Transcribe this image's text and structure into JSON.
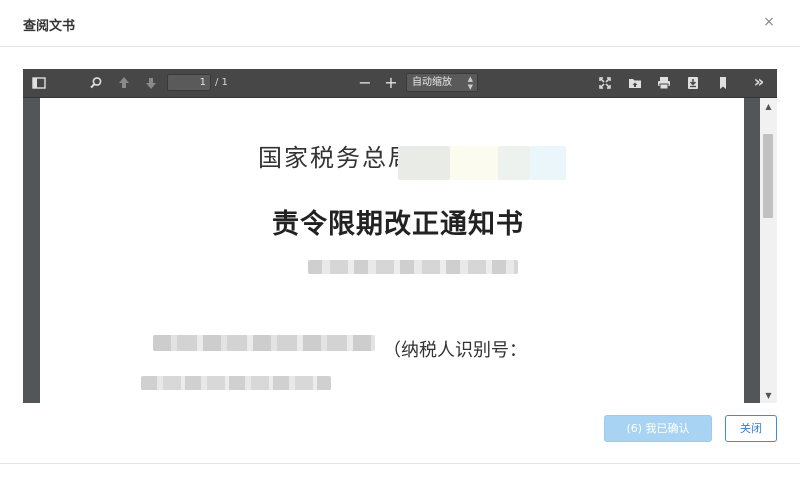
{
  "dialog": {
    "title": "查阅文书",
    "close_glyph": "×"
  },
  "viewer": {
    "toolbar": {
      "icons": [
        "sidebar-toggle-icon",
        "search-icon",
        "previous-page-icon",
        "next-page-icon",
        "zoom-out-icon",
        "zoom-in-icon",
        "presentation-mode-icon",
        "open-file-icon",
        "print-icon",
        "download-icon",
        "bookmark-icon",
        "tools-menu-icon"
      ],
      "page_number": "1",
      "page_total": "/ 1",
      "zoom_out_label": "−",
      "zoom_in_label": "+",
      "zoom_value": "自动缩放",
      "more_tools_label": "»"
    },
    "scrollbar": {
      "up_glyph": "▲",
      "down_glyph": "▼"
    },
    "document": {
      "authority_prefix": "国家税务总局",
      "title": "责令限期改正通知书",
      "taxpayer_id_label": "（纳税人识别号："
    }
  },
  "footer": {
    "confirm_label": "(6) 我已确认",
    "close_label": "关闭"
  },
  "colors": {
    "toolbar_bg": "#474747",
    "viewer_bg": "#525659",
    "confirm_disabled_bg": "#a9d3f3",
    "close_border": "#3c8dde"
  }
}
